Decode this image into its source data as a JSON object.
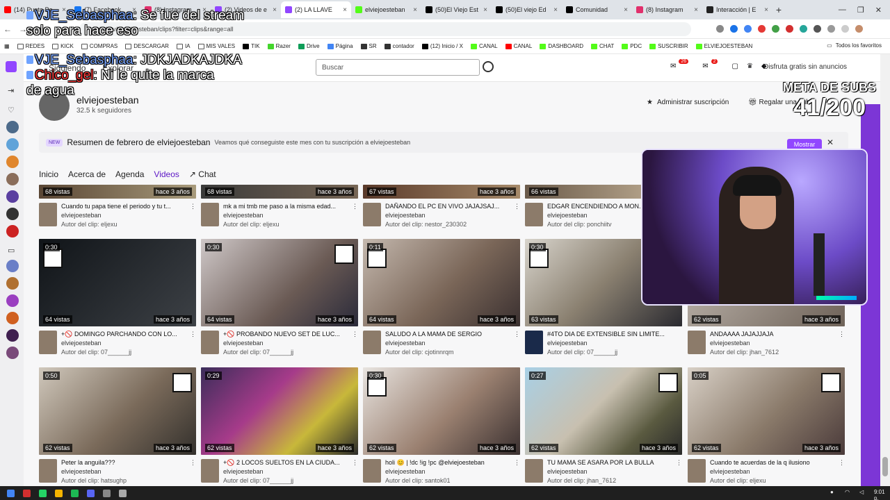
{
  "browser": {
    "tabs": [
      {
        "label": "(14) Punto Pa...",
        "color": "#ff0000"
      },
      {
        "label": "(7) Facebook",
        "color": "#1877f2"
      },
      {
        "label": "(8) Instagram",
        "color": "#e1306c"
      },
      {
        "label": "(2) Videos de e",
        "color": "#9146ff"
      },
      {
        "label": "(2) LA LLAVE",
        "color": "#9146ff"
      },
      {
        "label": "elviejoesteban",
        "color": "#53fc18"
      },
      {
        "label": "(50)El Viejo Est",
        "color": "#000000"
      },
      {
        "label": "(50)El viejo Ed",
        "color": "#000000"
      },
      {
        "label": "Comunidad",
        "color": "#000000"
      },
      {
        "label": "(8) Instagram",
        "color": "#e1306c"
      },
      {
        "label": "Interacción | E",
        "color": "#222222"
      }
    ],
    "url": "twitch.tv/elviejoesteban/clips?filter=clips&range=all",
    "bookmarks": [
      "REDES",
      "KICK",
      "COMPRAS",
      "DESCARGAR",
      "IA",
      "MIS VALES",
      "TIK",
      "Razer",
      "Drive",
      "Página",
      "SR",
      "contador",
      "(12) Inicio / X",
      "CANAL",
      "CANAL",
      "DASHBOARD",
      "CHAT",
      "PDC",
      "SUSCRIBIR",
      "ELVIEJOESTEBAN"
    ],
    "bookmarks_right": "Todos los favoritos"
  },
  "twitch": {
    "nav_following": "Siguiendo",
    "nav_explore": "Explorar",
    "search_placeholder": "Buscar",
    "notif_count1": "26",
    "notif_count2": "2",
    "ad_promo": "Disfruta gratis sin anuncios",
    "channel_name": "elviejoesteban",
    "followers": "32.5 k seguidores",
    "manage_sub": "Administrar suscripción",
    "gift_sub": "Regalar una sub",
    "banner_tag": "NEW",
    "banner_title": "Resumen de febrero de elviejoesteban",
    "banner_desc": "Veamos qué conseguiste este mes con tu suscripción a elviejoesteban",
    "banner_show": "Mostrar",
    "tabs": [
      "Inicio",
      "Acerca de",
      "Agenda",
      "Videos",
      "Chat"
    ]
  },
  "clips_partial": [
    {
      "views": "68 vistas",
      "age": "hace 3 años",
      "title": "Cuando tu papa tiene el periodo y tu t...",
      "channel": "elviejoesteban",
      "clip_author": "Autor del clip: eljexu"
    },
    {
      "views": "68 vistas",
      "age": "hace 3 años",
      "title": "mk a mi tmb me paso a la misma edad...",
      "channel": "elviejoesteban",
      "clip_author": "Autor del clip: eljexu"
    },
    {
      "views": "67 vistas",
      "age": "hace 3 años",
      "title": "DAÑANDO EL PC EN VIVO JAJAJSAJ...",
      "channel": "elviejoesteban",
      "clip_author": "Autor del clip: nestor_230302"
    },
    {
      "views": "66 vistas",
      "age": "hace 3 años",
      "title": "EDGAR ENCENDIENDO A MON...",
      "channel": "elviejoesteban",
      "clip_author": "Autor del clip: ponchiitv"
    }
  ],
  "clips_row2": [
    {
      "duration": "0:30",
      "views": "64 vistas",
      "age": "hace 3 años",
      "title": "+🚫 DOMINGO PARCHANDO CON LO...",
      "channel": "elviejoesteban",
      "clip_author": "Autor del clip: 07______jj"
    },
    {
      "duration": "0:30",
      "views": "64 vistas",
      "age": "hace 3 años",
      "title": "+🚫 PROBANDO NUEVO SET DE LUC...",
      "channel": "elviejoesteban",
      "clip_author": "Autor del clip: 07______jj"
    },
    {
      "duration": "0:11",
      "views": "64 vistas",
      "age": "hace 3 años",
      "title": "SALUDO A LA MAMA DE SERGIO",
      "channel": "elviejoesteban",
      "clip_author": "Autor del clip: cjotinnrqm"
    },
    {
      "duration": "0:30",
      "views": "63 vistas",
      "age": "hace 3 años",
      "title": "#4TO DIA DE EXTENSIBLE SIN LIMITE...",
      "channel": "elviejoesteban",
      "clip_author": "Autor del clip: 07______jj"
    },
    {
      "duration": "",
      "views": "62 vistas",
      "age": "hace 3 años",
      "title": "ANDAAAA JAJAJJAJA",
      "channel": "elviejoesteban",
      "clip_author": "Autor del clip: jhan_7612"
    }
  ],
  "clips_row3": [
    {
      "duration": "0:50",
      "views": "62 vistas",
      "age": "hace 3 años",
      "title": "Peter la anguila???",
      "channel": "elviejoesteban",
      "clip_author": "Autor del clip: hatsughp"
    },
    {
      "duration": "0:29",
      "views": "62 vistas",
      "age": "hace 3 años",
      "title": "+🚫 2 LOCOS SUELTOS EN LA CIUDA...",
      "channel": "elviejoesteban",
      "clip_author": "Autor del clip: 07______jj"
    },
    {
      "duration": "0:30",
      "views": "62 vistas",
      "age": "hace 3 años",
      "title": "holi 😊 | !dc !ig !pc @elviejoesteban",
      "channel": "elviejoesteban",
      "clip_author": "Autor del clip: santok01"
    },
    {
      "duration": "0:27",
      "views": "62 vistas",
      "age": "hace 3 años",
      "title": "TU MAMA SE ASARA POR LA BULLA",
      "channel": "elviejoesteban",
      "clip_author": "Autor del clip: jhan_7612"
    },
    {
      "duration": "0:05",
      "views": "62 vistas",
      "age": "hace 3 años",
      "title": "Cuando te acuerdas de la q ilusiono",
      "channel": "elviejoesteban",
      "clip_author": "Autor del clip: eljexu"
    }
  ],
  "overlay": {
    "chat": [
      {
        "user": "VJE_Sebasphaa",
        "msg": ": Se fue del stream"
      },
      {
        "user": "",
        "msg": "solo para hace eso"
      },
      {
        "user": "VJE_Sebasphaa",
        "msg": ": JDKJADKAJDKA"
      },
      {
        "user": "Chico_gel",
        "msg": ": Ni le quite la marca"
      },
      {
        "user": "",
        "msg": "de agua"
      }
    ],
    "sub_goal_label": "META DE SUBS",
    "sub_goal_value": "41/200"
  },
  "taskbar": {
    "time": "9:01 p. m."
  }
}
